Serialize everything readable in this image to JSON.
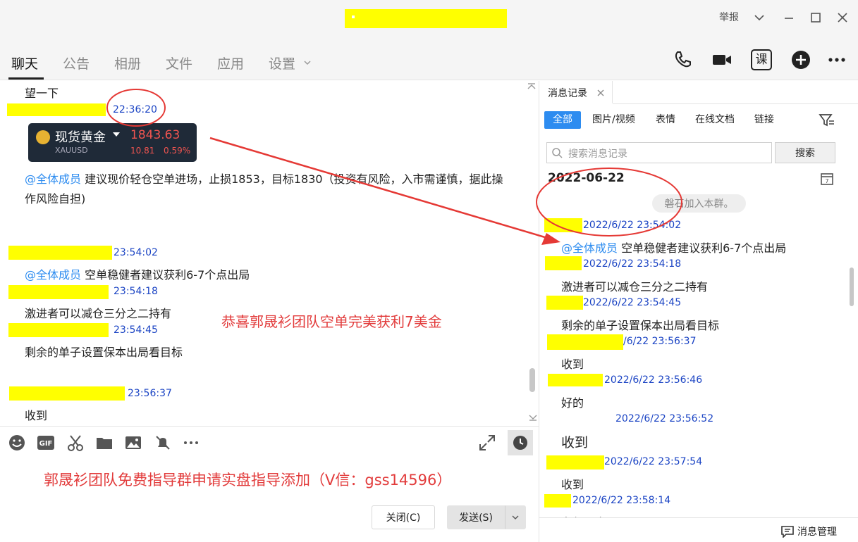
{
  "titlebar": {
    "report_label": "举报"
  },
  "tabs": [
    {
      "label": "聊天",
      "active": true
    },
    {
      "label": "公告"
    },
    {
      "label": "相册"
    },
    {
      "label": "文件"
    },
    {
      "label": "应用"
    },
    {
      "label": "设置"
    }
  ],
  "toolbar_right": {
    "course_label": "课"
  },
  "chat": {
    "first_line": "望一下",
    "ts1": "22:36:20",
    "gold_card": {
      "name": "现货黄金",
      "symbol": "XAUUSD",
      "price": "1843.63",
      "change": "10.81",
      "percent": "0.59%"
    },
    "mention": "@全体成员",
    "msg1": "建议现价轻仓空单进场，止损1853，目标1830（投资有风险，入市需谨慎，据此操",
    "msg1b": "作风险自担)",
    "ts2": "23:54:02",
    "msg2": "空单稳健者建议获利6-7个点出局",
    "ts3": "23:54:18",
    "msg3": "激进者可以减仓三分之二持有",
    "ts4": "23:54:45",
    "msg4": "剩余的单子设置保本出局看目标",
    "ts5": "23:56:37",
    "msg5": "收到"
  },
  "overlay": {
    "congrats": "恭喜郭晟衫团队空单完美获利7美金",
    "compose_ad": "郭晟衫团队免费指导群申请实盘指导添加（V信：gss14596）"
  },
  "compose": {
    "close_label": "关闭(C)",
    "send_label": "发送(S)"
  },
  "history": {
    "tab_label": "消息记录",
    "filters": [
      "全部",
      "图片/视频",
      "表情",
      "在线文档",
      "链接"
    ],
    "search_placeholder": "搜索消息记录",
    "search_button": "搜索",
    "date": "2022-06-22",
    "join_notice": "磐石加入本群。",
    "items": [
      {
        "ts": "2022/6/22 23:54:02",
        "mention": "@全体成员",
        "text": "空单稳健者建议获利6-7个点出局"
      },
      {
        "ts": "2022/6/22 23:54:18",
        "text": "激进者可以减仓三分之二持有"
      },
      {
        "ts": "2022/6/22 23:54:45",
        "text": "剩余的单子设置保本出局看目标"
      },
      {
        "ts": "/6/22 23:56:37",
        "text": "收到"
      },
      {
        "ts": "2022/6/22 23:56:46",
        "text": "好的"
      },
      {
        "ts": "2022/6/22 23:56:52",
        "text": "收到"
      },
      {
        "ts": "2022/6/22 23:57:54",
        "text": "收到"
      },
      {
        "ts": "2022/6/22 23:58:14",
        "text": "老师厉害"
      }
    ],
    "manage_label": "消息管理"
  }
}
